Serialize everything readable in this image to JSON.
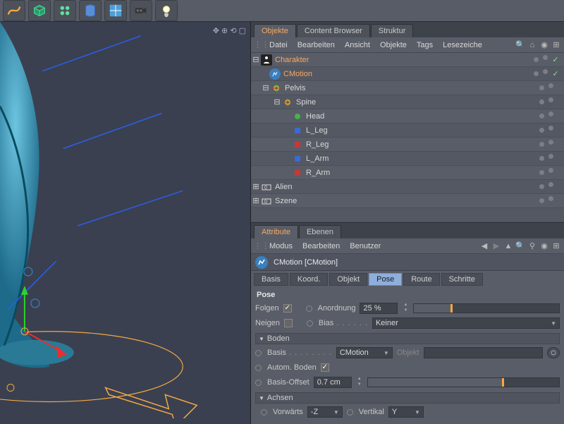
{
  "top_tabs": {
    "objects": "Objekte",
    "content": "Content Browser",
    "structure": "Struktur"
  },
  "obj_menu": {
    "file": "Datei",
    "edit": "Bearbeiten",
    "view": "Ansicht",
    "objects": "Objekte",
    "tags": "Tags",
    "bookmarks": "Lesezeiche"
  },
  "tree": {
    "charakter": "Charakter",
    "cmotion": "CMotion",
    "pelvis": "Pelvis",
    "spine": "Spine",
    "head": "Head",
    "lleg": "L_Leg",
    "rleg": "R_Leg",
    "larm": "L_Arm",
    "rarm": "R_Arm",
    "alien": "Alien",
    "szene": "Szene"
  },
  "attr_tabs": {
    "attribute": "Attribute",
    "layers": "Ebenen"
  },
  "attr_menu": {
    "mode": "Modus",
    "edit": "Bearbeiten",
    "user": "Benutzer"
  },
  "attr_header": "CMotion [CMotion]",
  "subtabs": {
    "basis": "Basis",
    "koord": "Koord.",
    "objekt": "Objekt",
    "pose": "Pose",
    "route": "Route",
    "schritte": "Schritte"
  },
  "pose": {
    "section": "Pose",
    "folgen": "Folgen",
    "anordnung": "Anordnung",
    "anordnung_val": "25 %",
    "anordnung_pct": 25,
    "neigen": "Neigen",
    "bias": "Bias",
    "bias_val": "Keiner",
    "boden_group": "Boden",
    "basis": "Basis",
    "basis_val": "CMotion",
    "objekt": "Objekt",
    "autom_boden": "Autom. Boden",
    "basis_offset": "Basis-Offset",
    "basis_offset_val": "0.7 cm",
    "basis_offset_pct": 70,
    "achsen_group": "Achsen",
    "vorwarts": "Vorwärts",
    "vorwarts_val": "-Z",
    "vertikal": "Vertikal",
    "vertikal_val": "Y"
  }
}
